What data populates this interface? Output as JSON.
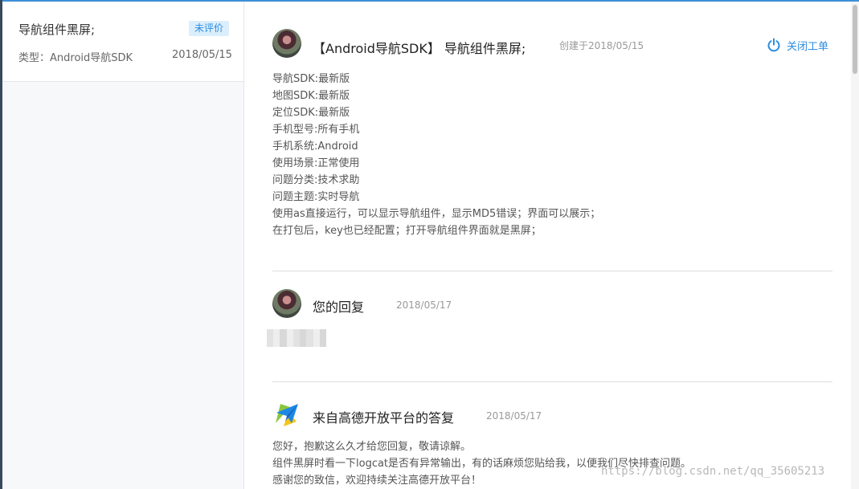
{
  "sidebar": {
    "ticket": {
      "title": "导航组件黑屏;",
      "badge": "未评价",
      "type": "类型：Android导航SDK",
      "date": "2018/05/15"
    }
  },
  "ticket": {
    "title": "【Android导航SDK】 导航组件黑屏;",
    "created": "创建于2018/05/15",
    "close_label": "关闭工单",
    "body": [
      "导航SDK:最新版",
      "地图SDK:最新版",
      "定位SDK:最新版",
      "手机型号:所有手机",
      "手机系统:Android",
      "使用场景:正常使用",
      "问题分类:技术求助",
      "问题主题:实时导航",
      "使用as直接运行，可以显示导航组件，显示MD5错误；界面可以展示；",
      "在打包后，key也已经配置；打开导航组件界面就是黑屏；"
    ]
  },
  "my_reply": {
    "title": "您的回复",
    "date": "2018/05/17"
  },
  "official_reply": {
    "title": "来自高德开放平台的答复",
    "date": "2018/05/17",
    "body": [
      "您好，抱歉这么久才给您回复，敬请谅解。",
      "组件黑屏时看一下logcat是否有异常输出，有的话麻烦您贴给我，以便我们尽快排查问题。",
      "感谢您的致信，欢迎持续关注高德开放平台！"
    ]
  },
  "watermark": "https://blog.csdn.net/qq_35605213",
  "colors": {
    "accent": "#2d8de0",
    "badge_bg": "#dbeefc",
    "left_edge": "#3a4a5c"
  },
  "icons": {
    "close": "power-icon",
    "avatar_user": "user-avatar",
    "avatar_official": "paper-plane-logo"
  }
}
